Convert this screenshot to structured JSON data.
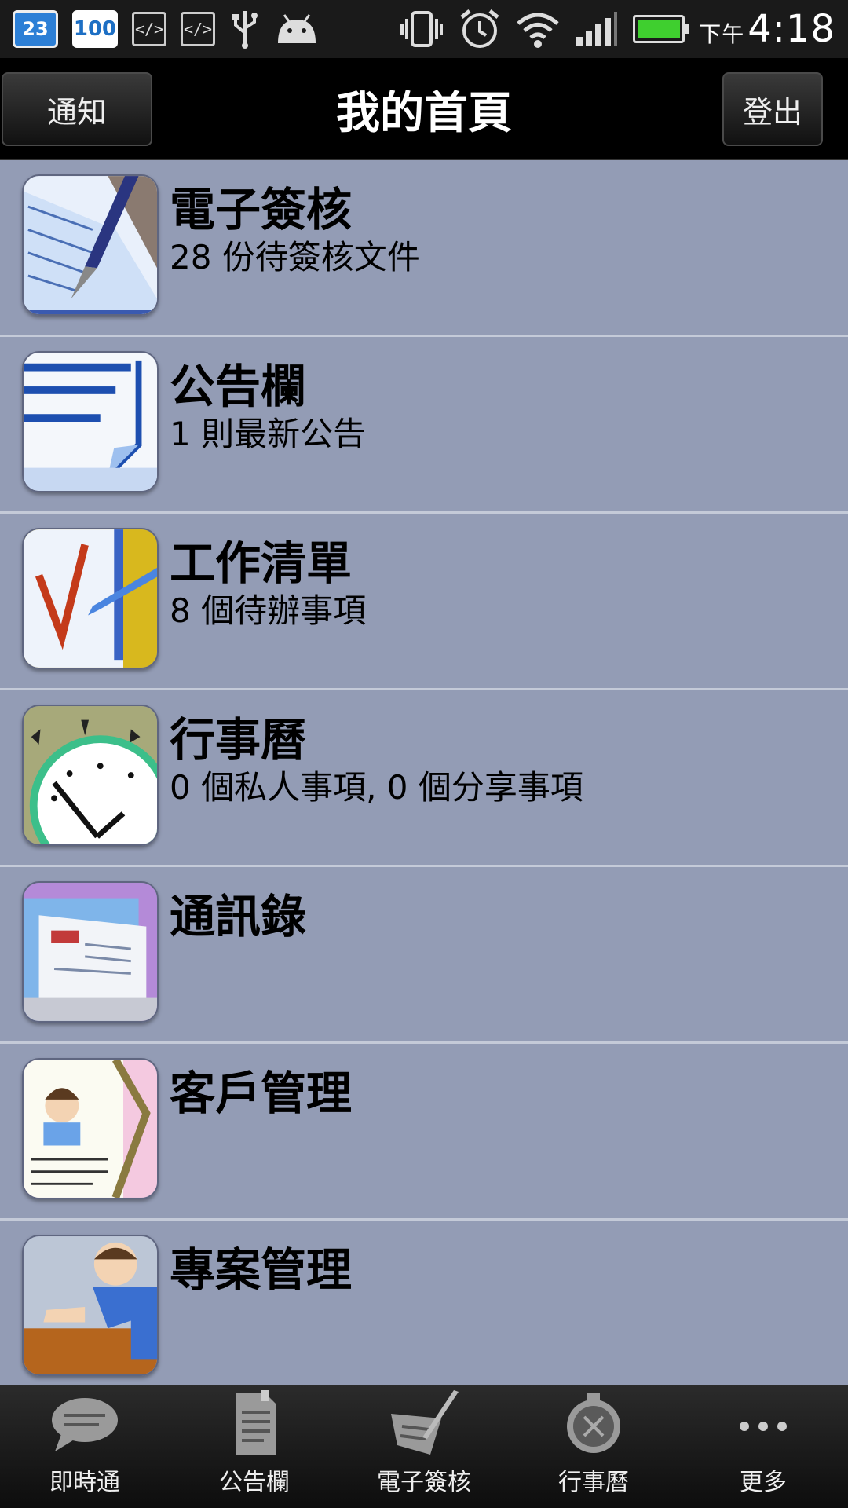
{
  "status_bar": {
    "calendar_day": "23",
    "battery_badge": "100",
    "time_period": "下午",
    "time": "4:18",
    "icons": [
      "calendar-icon",
      "battery-badge-icon",
      "code-icon",
      "code-icon",
      "usb-icon",
      "android-icon",
      "vibrate-icon",
      "alarm-icon",
      "wifi-icon",
      "signal-icon",
      "battery-icon"
    ]
  },
  "header": {
    "left_button": "通知",
    "title": "我的首頁",
    "right_button": "登出"
  },
  "list": {
    "items": [
      {
        "title": "電子簽核",
        "subtitle": "28 份待簽核文件",
        "icon": "pen-sign-icon"
      },
      {
        "title": "公告欄",
        "subtitle": "1 則最新公告",
        "icon": "notice-board-icon"
      },
      {
        "title": "工作清單",
        "subtitle": "8 個待辦事項",
        "icon": "checklist-icon"
      },
      {
        "title": "行事曆",
        "subtitle": "0 個私人事項, 0 個分享事項",
        "icon": "clock-icon"
      },
      {
        "title": "通訊錄",
        "subtitle": "",
        "icon": "address-book-icon"
      },
      {
        "title": "客戶管理",
        "subtitle": "",
        "icon": "customer-card-icon"
      },
      {
        "title": "專案管理",
        "subtitle": "",
        "icon": "project-person-icon"
      }
    ],
    "background": "#939cb5"
  },
  "tabbar": {
    "tabs": [
      {
        "label": "即時通",
        "icon": "chat-bubble-icon"
      },
      {
        "label": "公告欄",
        "icon": "document-icon"
      },
      {
        "label": "電子簽核",
        "icon": "sign-pen-icon"
      },
      {
        "label": "行事曆",
        "icon": "stopwatch-icon"
      },
      {
        "label": "更多",
        "icon": "more-dots-icon"
      }
    ]
  }
}
